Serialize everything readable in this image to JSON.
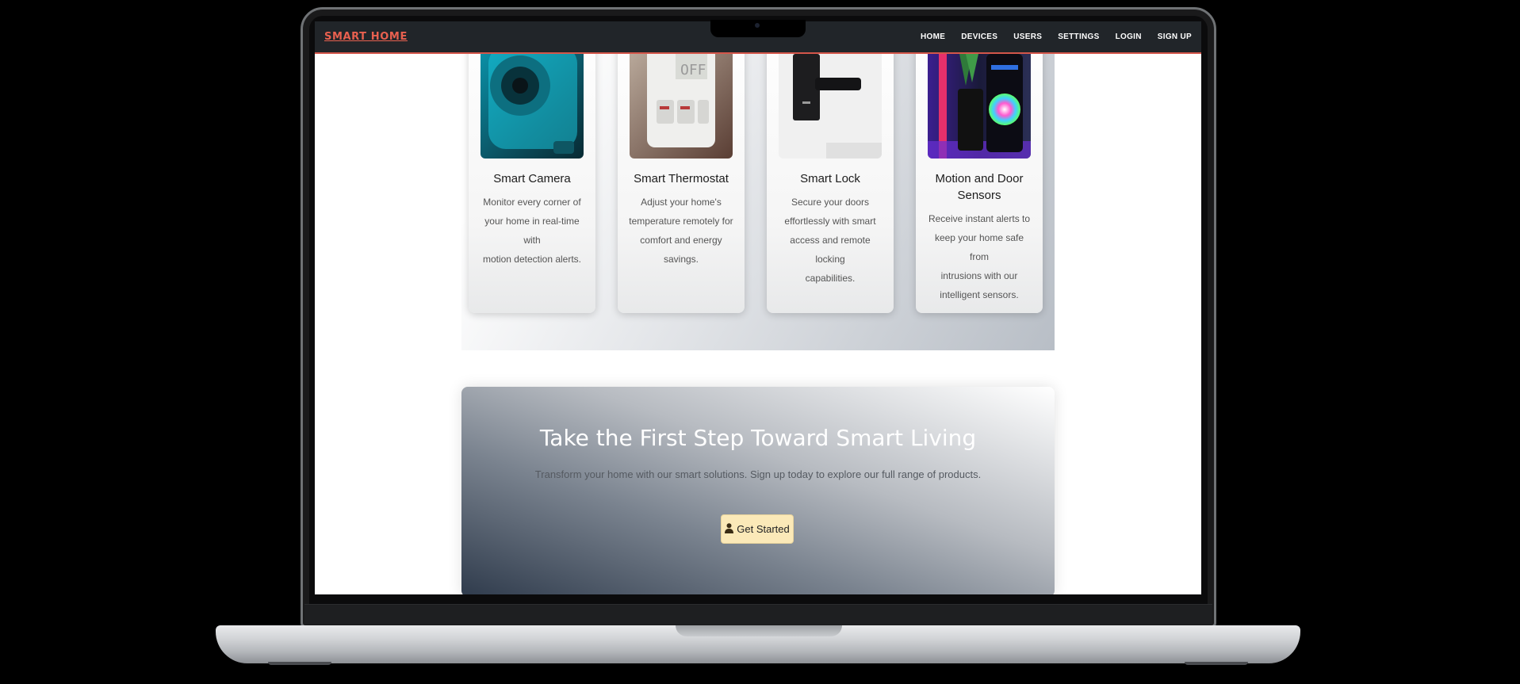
{
  "navbar": {
    "brand": "SMART HOME",
    "links": [
      "HOME",
      "DEVICES",
      "USERS",
      "SETTINGS",
      "LOGIN",
      "SIGN UP"
    ]
  },
  "devices": [
    {
      "title": "Smart Camera",
      "lines": [
        "Monitor every corner of",
        "your home in real-time with",
        "motion detection alerts."
      ]
    },
    {
      "title": "Smart Thermostat",
      "lines": [
        "Adjust your home's",
        "temperature remotely for",
        "comfort and energy savings."
      ]
    },
    {
      "title": "Smart Lock",
      "lines": [
        "Secure your doors",
        "effortlessly with smart",
        "access and remote locking",
        "capabilities."
      ]
    },
    {
      "title_lines": [
        "Motion and Door",
        "Sensors"
      ],
      "lines": [
        "Receive instant alerts to",
        "keep your home safe from",
        "intrusions with our",
        "intelligent sensors."
      ]
    }
  ],
  "cta": {
    "title": "Take the First Step Toward Smart Living",
    "subtitle": "Transform your home with our smart solutions. Sign up today to explore our full range of products.",
    "button_label": "Get Started",
    "button_icon": "user-icon"
  },
  "colors": {
    "navbar_bg": "#212529",
    "brand": "#e8604f",
    "accent_border": "#d3564a",
    "cta_button": "#fbe9b8"
  }
}
